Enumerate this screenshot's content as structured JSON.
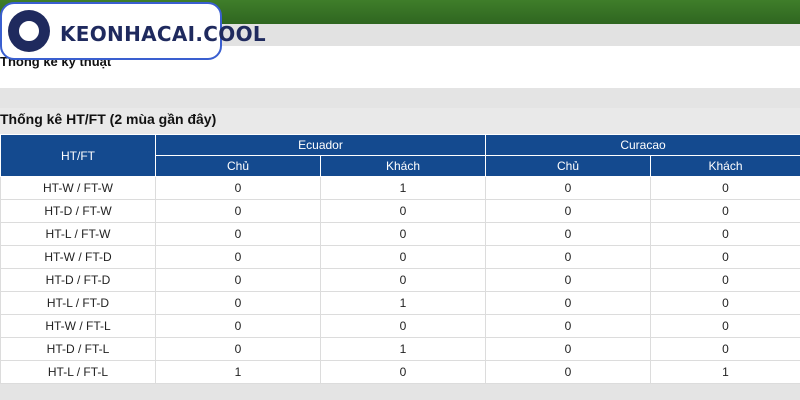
{
  "logo": {
    "text": "KEONHACAI.COOL"
  },
  "section_title": "Thống kê kỹ thuật",
  "htft_title": "Thống kê HT/FT (2 mùa gần đây)",
  "table": {
    "first_header": "HT/FT",
    "teams": [
      "Ecuador",
      "Curacao"
    ],
    "sub_headers": [
      "Chủ",
      "Khách",
      "Chủ",
      "Khách"
    ],
    "rows": [
      {
        "label": "HT-W / FT-W",
        "values": [
          "0",
          "1",
          "0",
          "0"
        ]
      },
      {
        "label": "HT-D / FT-W",
        "values": [
          "0",
          "0",
          "0",
          "0"
        ]
      },
      {
        "label": "HT-L / FT-W",
        "values": [
          "0",
          "0",
          "0",
          "0"
        ]
      },
      {
        "label": "HT-W / FT-D",
        "values": [
          "0",
          "0",
          "0",
          "0"
        ]
      },
      {
        "label": "HT-D / FT-D",
        "values": [
          "0",
          "0",
          "0",
          "0"
        ]
      },
      {
        "label": "HT-L / FT-D",
        "values": [
          "0",
          "1",
          "0",
          "0"
        ]
      },
      {
        "label": "HT-W / FT-L",
        "values": [
          "0",
          "0",
          "0",
          "0"
        ]
      },
      {
        "label": "HT-D / FT-L",
        "values": [
          "0",
          "1",
          "0",
          "0"
        ]
      },
      {
        "label": "HT-L / FT-L",
        "values": [
          "1",
          "0",
          "0",
          "1"
        ]
      }
    ]
  }
}
